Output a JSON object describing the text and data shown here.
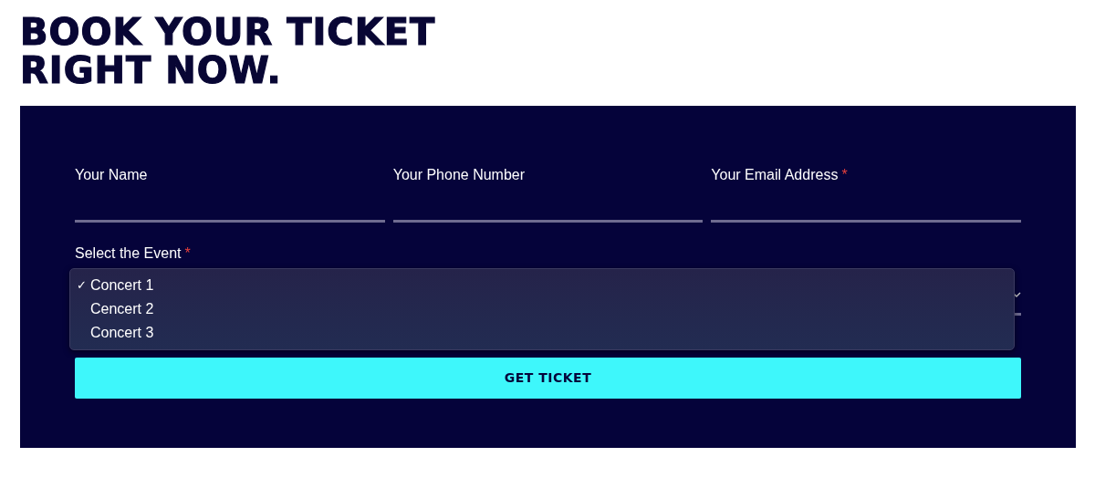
{
  "heading": [
    "BOOK YOUR TICKET",
    "RIGHT NOW."
  ],
  "fields": [
    {
      "label": "Your Name"
    },
    {
      "label": "Your Phone Number"
    },
    {
      "label": "Your Email Address",
      "marker": "*"
    }
  ],
  "event_select": {
    "label": "Select the Event",
    "marker": "*",
    "check": "✓",
    "expanded": true,
    "options": [
      {
        "label": "Concert 1",
        "selected": true
      },
      {
        "label": "Cencert 2",
        "selected": false
      },
      {
        "label": "Concert 3",
        "selected": false
      }
    ]
  },
  "submit_button": "GET TICKET"
}
